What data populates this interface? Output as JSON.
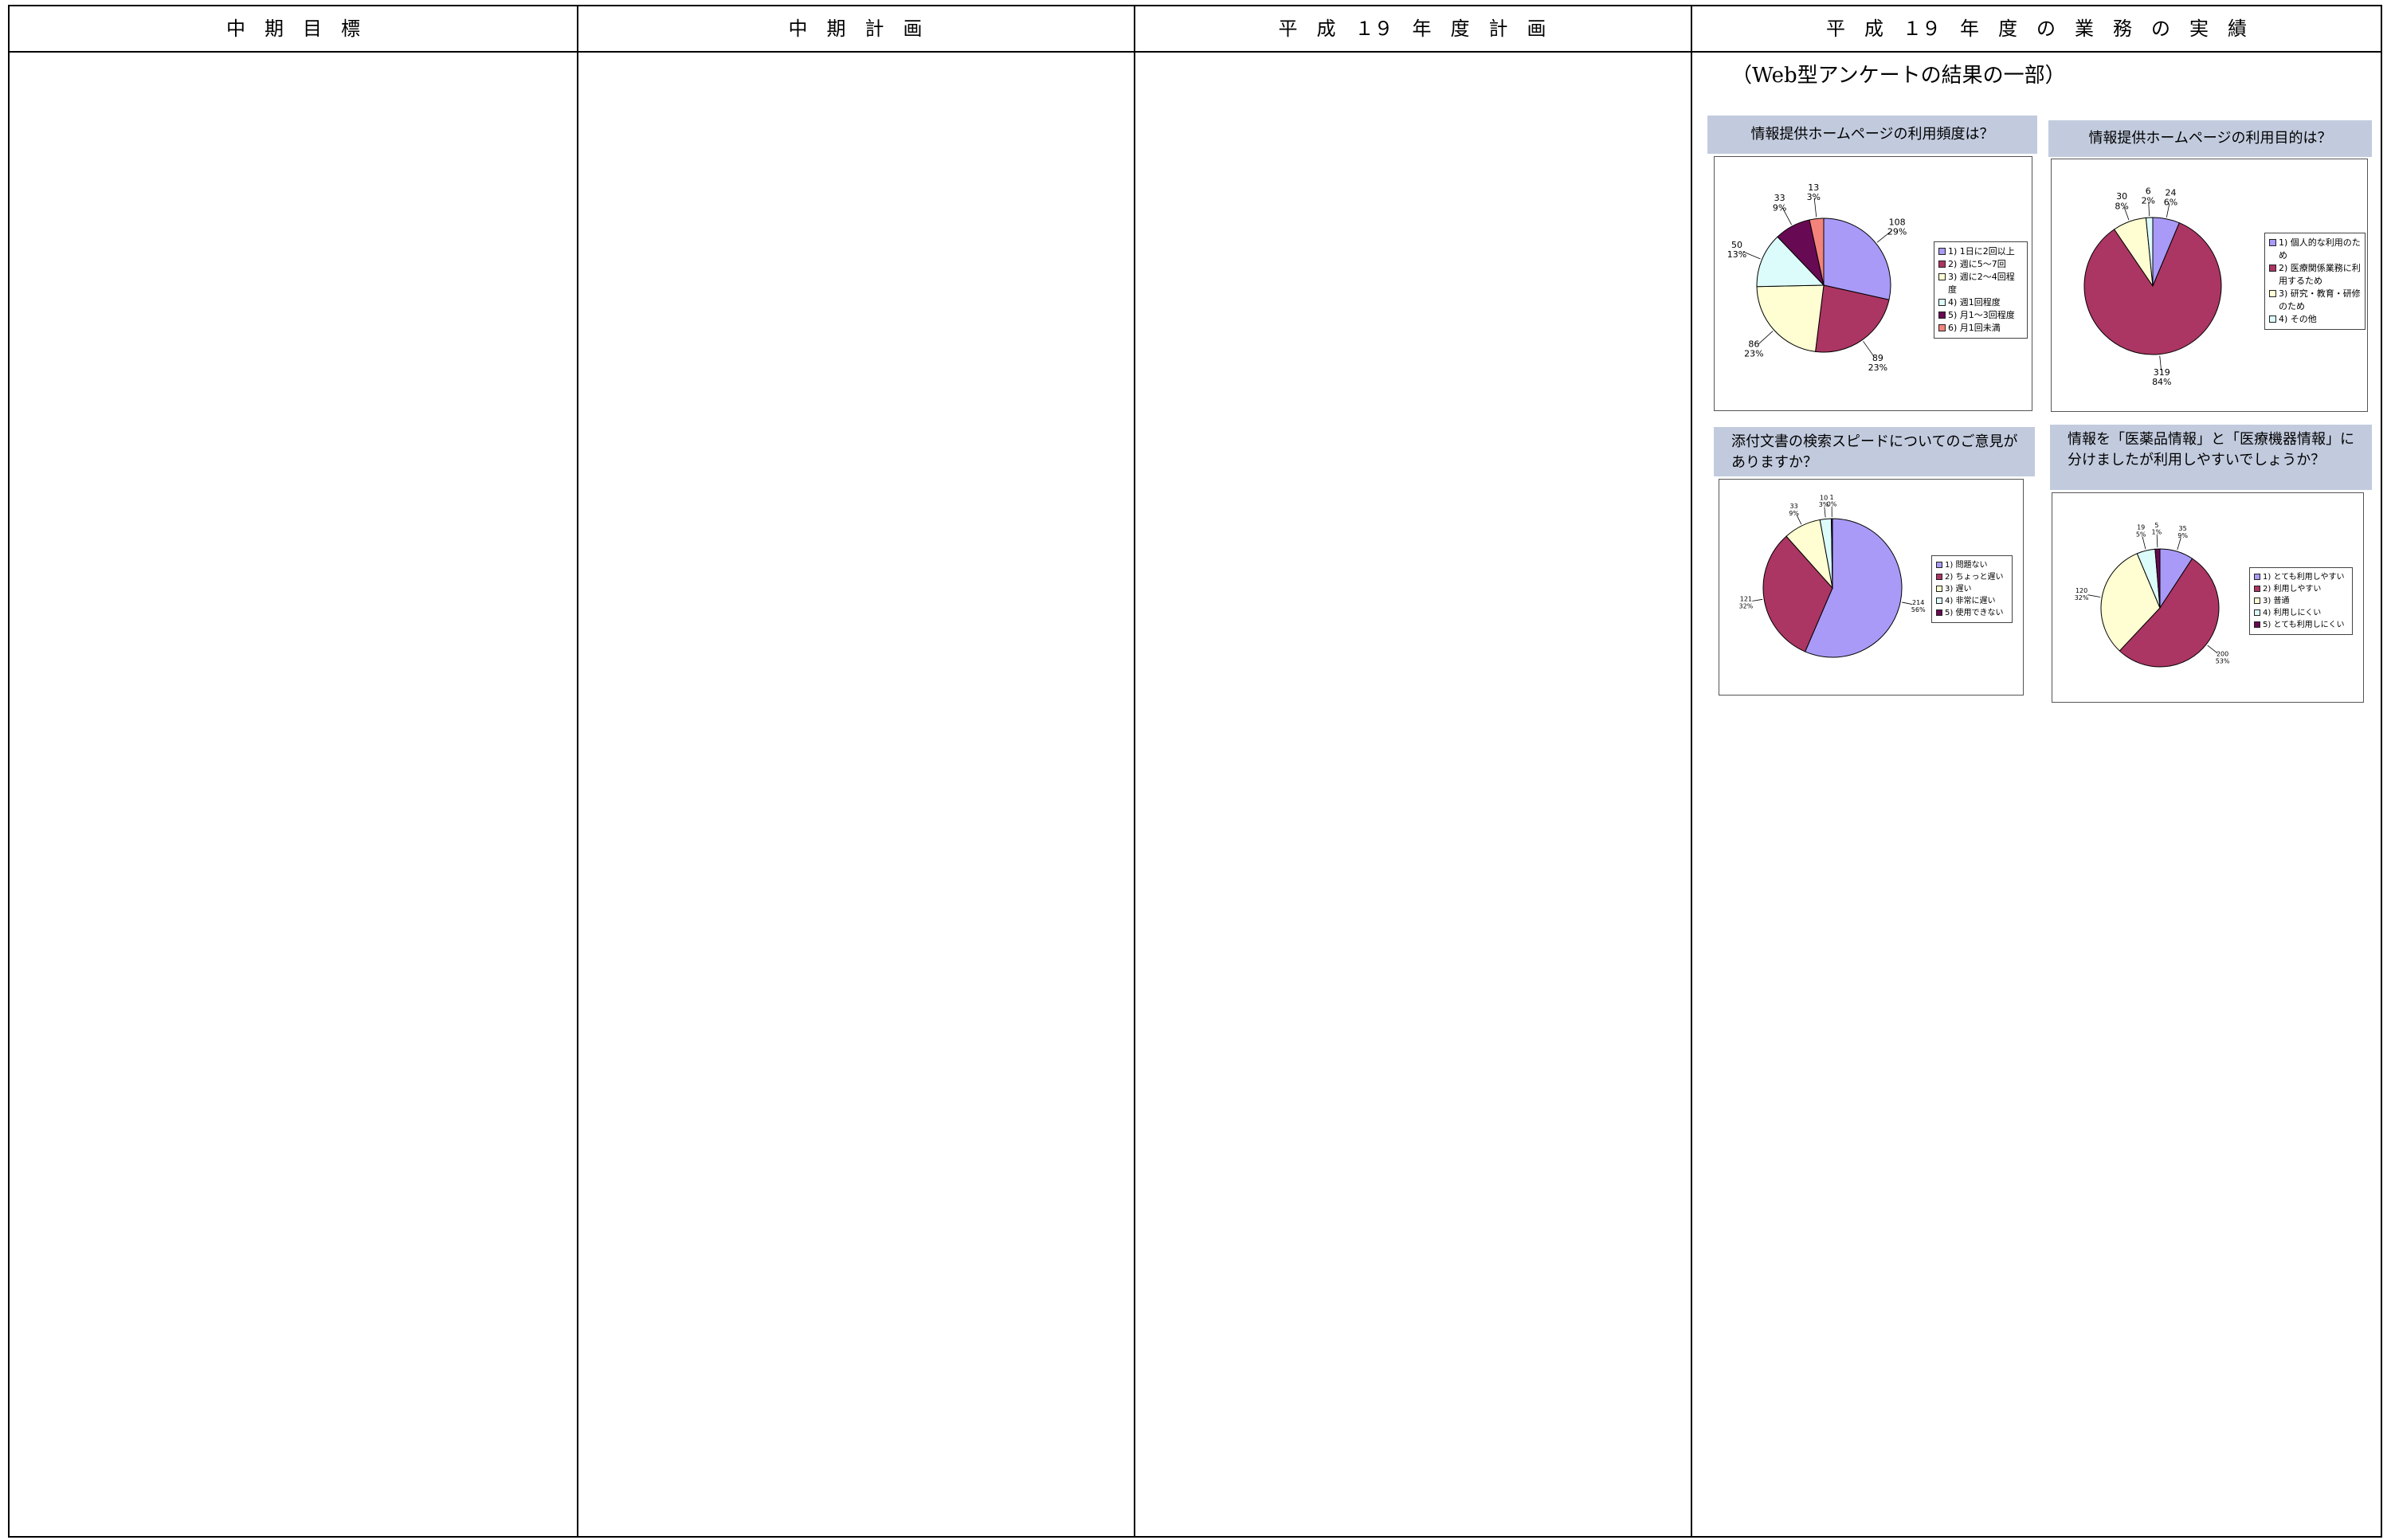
{
  "headers": [
    "中　期　目　標",
    "中　期　計　画",
    "平　成　１９　年　度　計　画",
    "平　成　１９　年　度　の　業　務　の　実　績"
  ],
  "caption": "（Web型アンケートの結果の一部）",
  "colors": {
    "header_bar": "#c2cbde",
    "lavender": "#a99af7",
    "maroon": "#ab3563",
    "cream": "#fefed2",
    "light_cyan": "#dcfbfb",
    "dark_purple": "#680a53",
    "salmon": "#f3837b"
  },
  "chart_data": [
    {
      "type": "pie",
      "title": "情報提供ホームページの利用頻度は？",
      "categories": [
        "1) 1日に2回以上",
        "2) 週に5～7回",
        "3) 週に2～4回程度",
        "4) 週1回程度",
        "5) 月1～3回程度",
        "6) 月1回未満"
      ],
      "values": [
        108,
        89,
        86,
        50,
        33,
        13
      ],
      "percent_labels": [
        "29%",
        "23%",
        "23%",
        "13%",
        "9%",
        "3%"
      ],
      "colors": [
        "#a99af7",
        "#ab3563",
        "#fefed2",
        "#dcfbfb",
        "#680a53",
        "#f3837b"
      ],
      "legend": "right"
    },
    {
      "type": "pie",
      "title": "情報提供ホームページの利用目的は？",
      "categories": [
        "1) 個人的な利用のため",
        "2) 医療関係業務に利用するため",
        "3) 研究・教育・研修のため",
        "4) その他"
      ],
      "values": [
        24,
        319,
        30,
        6
      ],
      "percent_labels": [
        "6%",
        "84%",
        "8%",
        "2%"
      ],
      "colors": [
        "#a99af7",
        "#ab3563",
        "#fefed2",
        "#dcfbfb"
      ],
      "legend": "right"
    },
    {
      "type": "pie",
      "title": "添付文書の検索スピードについてのご意見がありますか？",
      "categories": [
        "1) 問題ない",
        "2) ちょっと遅い",
        "3) 遅い",
        "4) 非常に遅い",
        "5) 使用できない"
      ],
      "values": [
        214,
        121,
        33,
        10,
        1
      ],
      "percent_labels": [
        "56%",
        "32%",
        "9%",
        "3%",
        "0%"
      ],
      "colors": [
        "#a99af7",
        "#ab3563",
        "#fefed2",
        "#dcfbfb",
        "#680a53"
      ],
      "legend": "right"
    },
    {
      "type": "pie",
      "title": "情報を「医薬品情報」と「医療機器情報」に分けましたが利用しやすいでしょうか？",
      "categories": [
        "1) とても利用しやすい",
        "2) 利用しやすい",
        "3) 普通",
        "4) 利用しにくい",
        "5) とても利用しにくい"
      ],
      "values": [
        35,
        200,
        120,
        19,
        5
      ],
      "percent_labels": [
        "9%",
        "53%",
        "32%",
        "5%",
        "1%"
      ],
      "colors": [
        "#a99af7",
        "#ab3563",
        "#fefed2",
        "#dcfbfb",
        "#680a53"
      ],
      "legend": "right"
    }
  ]
}
